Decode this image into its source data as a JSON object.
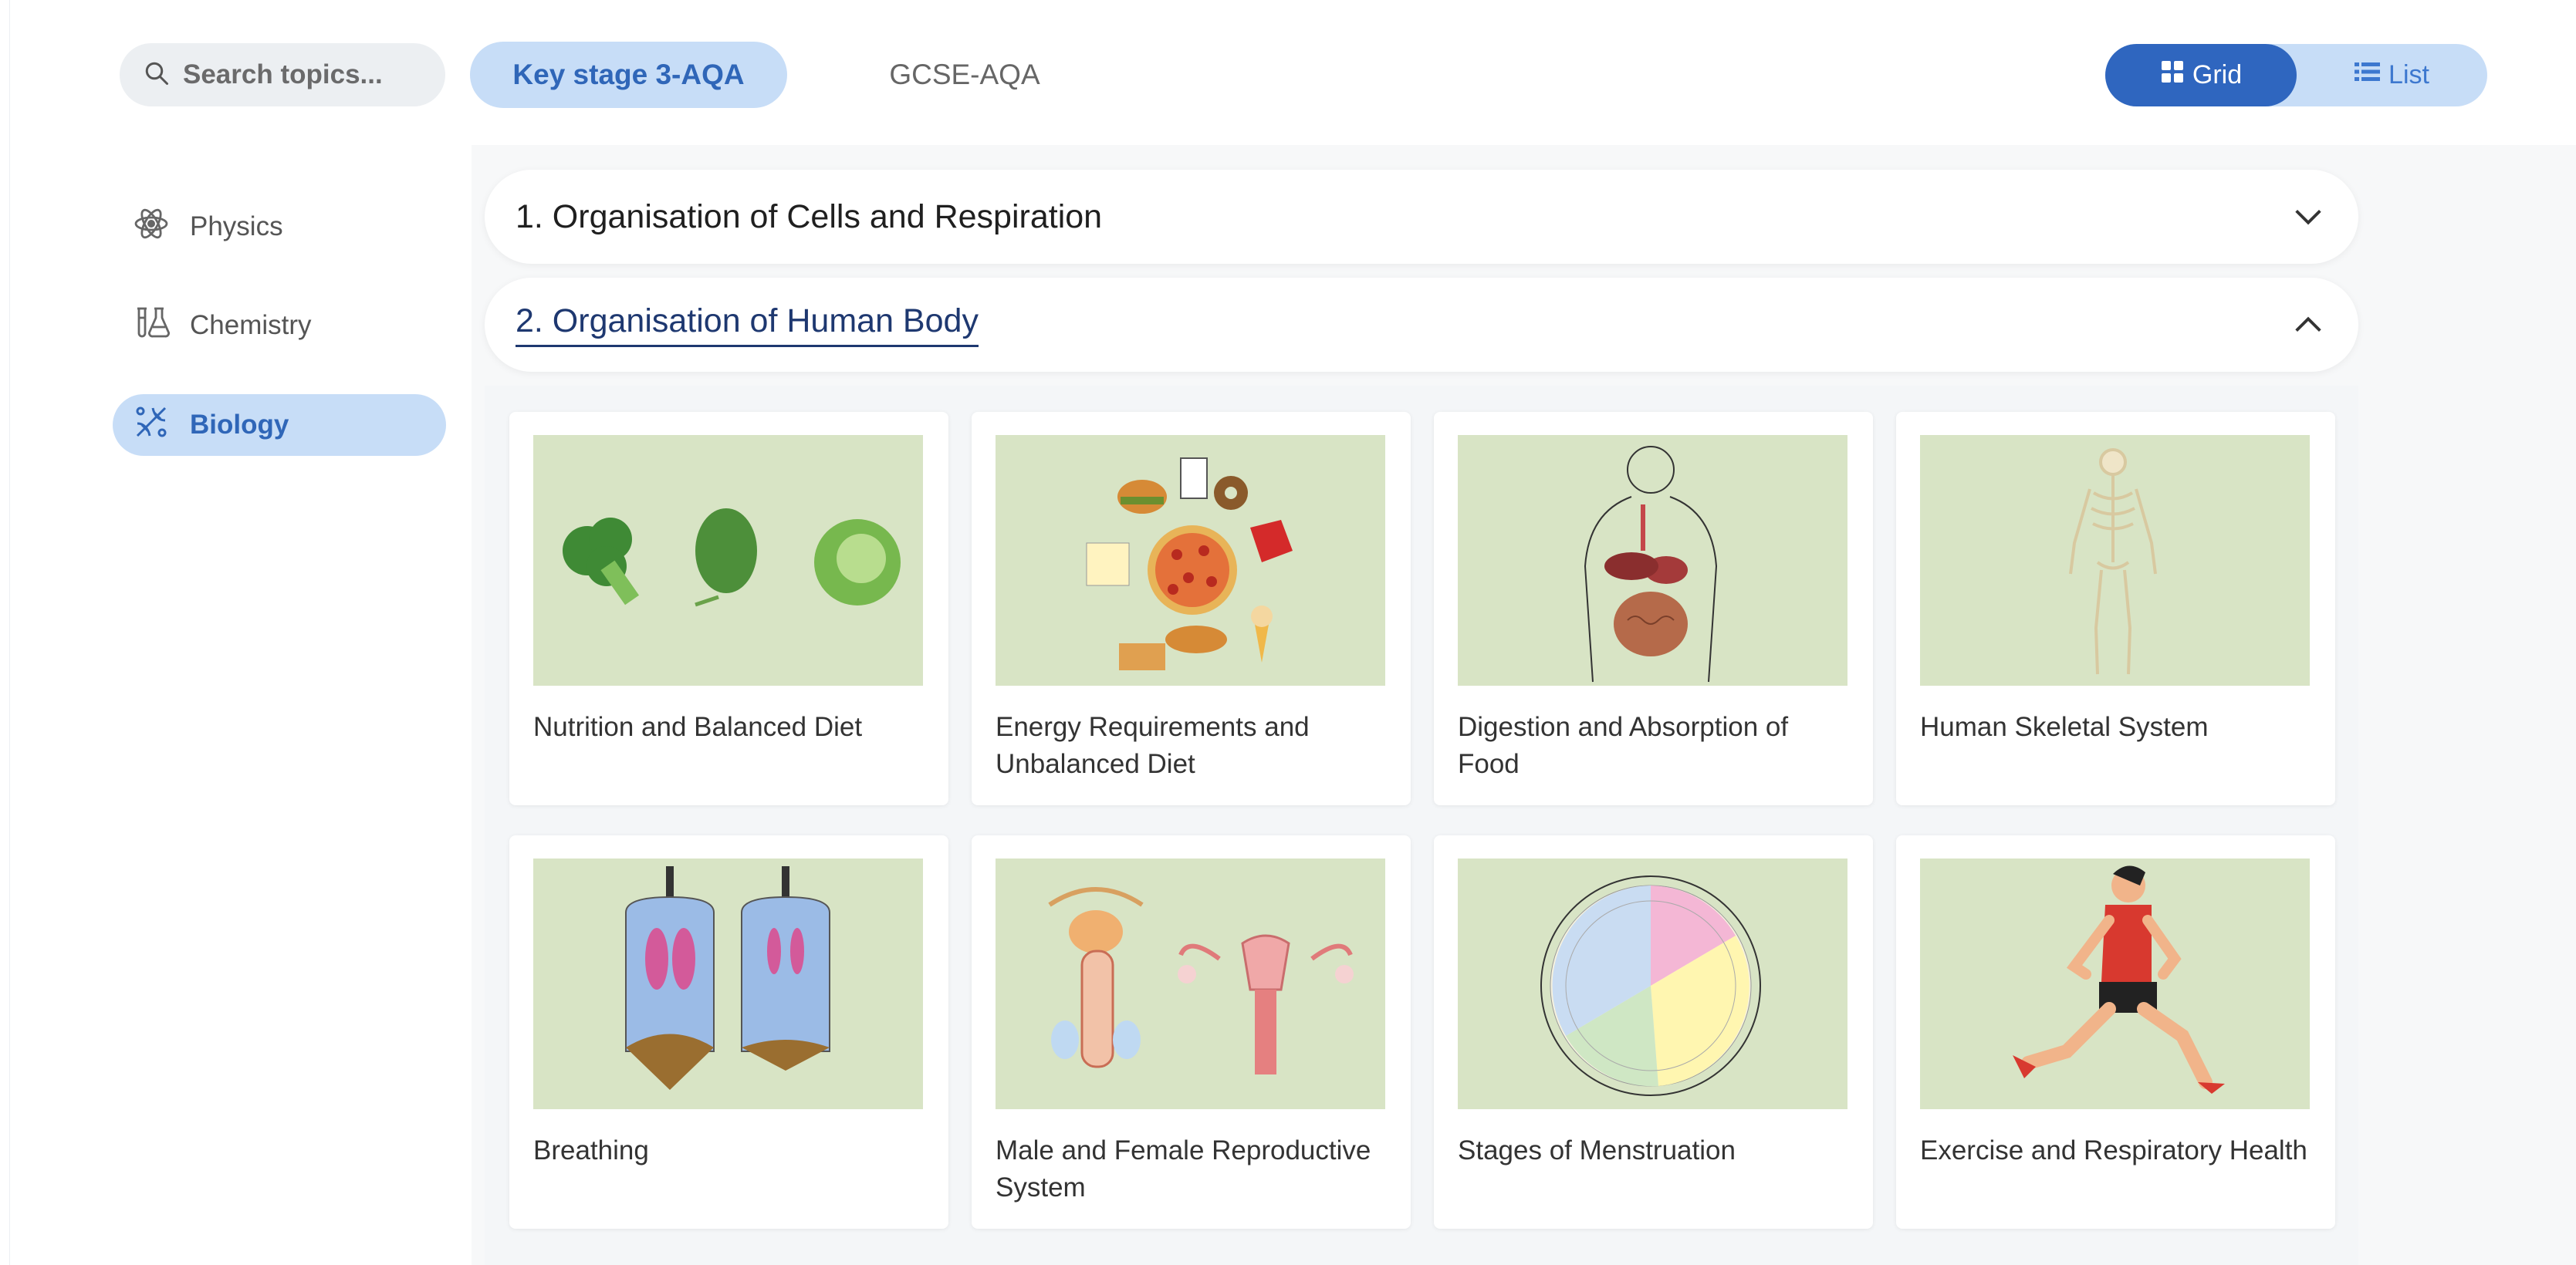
{
  "search": {
    "placeholder": "Search topics..."
  },
  "tabs": {
    "ks3": "Key stage 3-AQA",
    "gcse": "GCSE-AQA"
  },
  "view_toggle": {
    "grid": "Grid",
    "list": "List",
    "selected": "Grid"
  },
  "sidebar": {
    "items": [
      {
        "label": "Physics",
        "icon": "atom-icon",
        "active": false
      },
      {
        "label": "Chemistry",
        "icon": "flask-icon",
        "active": false
      },
      {
        "label": "Biology",
        "icon": "dna-icon",
        "active": true
      }
    ]
  },
  "sections": [
    {
      "title": "1. Organisation of Cells and Respiration",
      "expanded": false
    },
    {
      "title": "2. Organisation of Human Body",
      "expanded": true
    }
  ],
  "cards": [
    {
      "title": "Nutrition and Balanced Diet",
      "image": "vegetables-image"
    },
    {
      "title": "Energy Requirements and Unbalanced Diet",
      "image": "junk-food-image"
    },
    {
      "title": "Digestion and Absorption of Food",
      "image": "digestive-system-image"
    },
    {
      "title": "Human Skeletal System",
      "image": "skeleton-image"
    },
    {
      "title": "Breathing",
      "image": "bell-jar-lungs-image"
    },
    {
      "title": "Male and Female Reproductive System",
      "image": "reproductive-system-image"
    },
    {
      "title": "Stages of Menstruation",
      "image": "menstrual-cycle-image"
    },
    {
      "title": "Exercise and Respiratory Health",
      "image": "runner-image"
    }
  ],
  "colors": {
    "accent": "#2f66bf",
    "accent_light": "#c7ddf7",
    "thumb_bg": "#d8e4c5",
    "section_title_active": "#1e3870"
  }
}
